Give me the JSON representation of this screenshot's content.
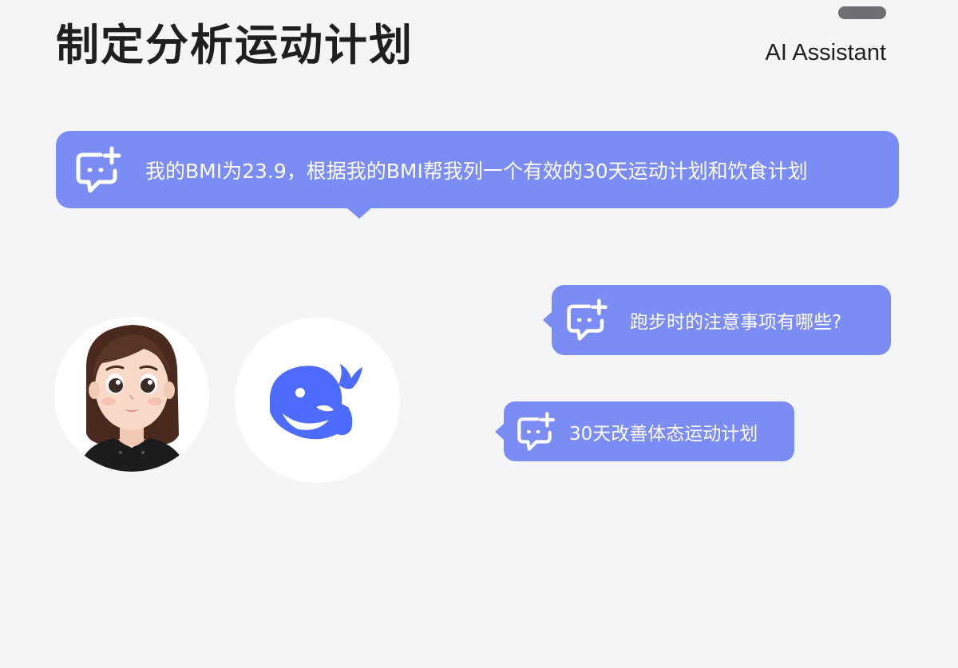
{
  "header": {
    "title": "制定分析运动计划",
    "brand": "AI Assistant"
  },
  "prompts": {
    "main": "我的BMI为23.9，根据我的BMI帮我列一个有效的30天运动计划和饮食计划",
    "question_1": "跑步时的注意事项有哪些?",
    "question_2": "30天改善体态运动计划"
  },
  "icons": {
    "prompt_icon": "chat-bubble-plus-icon",
    "user_avatar": "woman-avatar",
    "assistant_logo": "whale-logo"
  },
  "colors": {
    "background": "#f4f5f7",
    "bubble": "#7b8cf5",
    "whale": "#4d6bfe",
    "title": "#1f1f1f"
  }
}
